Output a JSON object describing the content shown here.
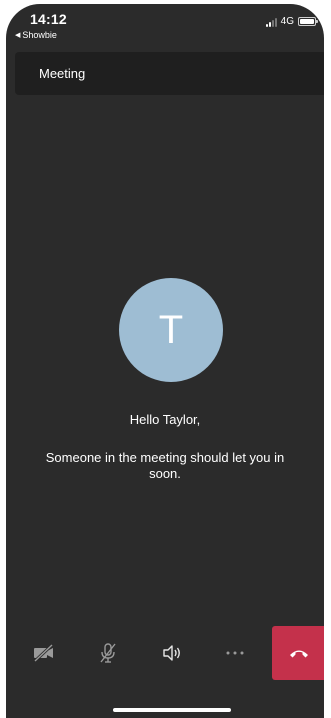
{
  "status_bar": {
    "time": "14:12",
    "back_app": "Showbie",
    "network": "4G"
  },
  "header": {
    "title": "Meeting"
  },
  "lobby": {
    "avatar_initial": "T",
    "greeting": "Hello Taylor,",
    "message": "Someone in the meeting should let you in soon."
  },
  "controls": {
    "camera_icon": "camera-off-icon",
    "mic_icon": "mic-off-icon",
    "speaker_icon": "speaker-icon",
    "more_icon": "more-options-icon",
    "hangup_icon": "hang-up-icon"
  },
  "colors": {
    "background": "#2b2b2b",
    "header": "#1f1f1f",
    "avatar": "#9ebdd3",
    "hangup": "#c4314b"
  }
}
